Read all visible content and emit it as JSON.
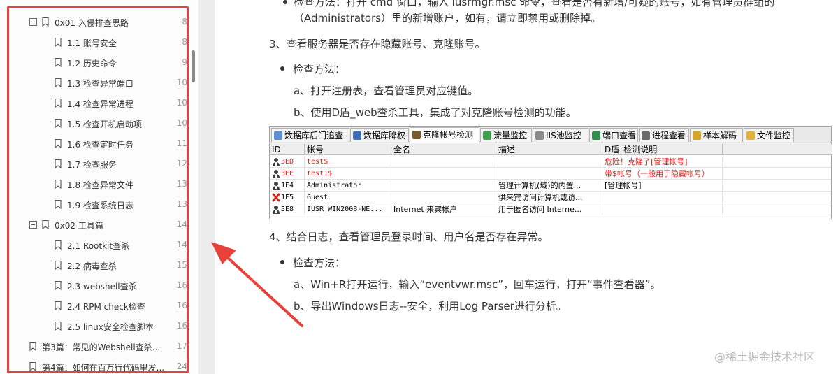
{
  "toc": {
    "items": [
      {
        "level": 1,
        "collapsible": true,
        "label": "0x01 入侵排查思路",
        "page": "8"
      },
      {
        "level": 2,
        "collapsible": false,
        "label": "1.1 账号安全",
        "page": "8"
      },
      {
        "level": 2,
        "collapsible": false,
        "label": "1.2 历史命令",
        "page": "9"
      },
      {
        "level": 2,
        "collapsible": false,
        "label": "1.3 检查异常端口",
        "page": "10"
      },
      {
        "level": 2,
        "collapsible": false,
        "label": "1.4 检查异常进程",
        "page": "10"
      },
      {
        "level": 2,
        "collapsible": false,
        "label": "1.5 检查开机启动项",
        "page": "10"
      },
      {
        "level": 2,
        "collapsible": false,
        "label": "1.6 检查定时任务",
        "page": "11"
      },
      {
        "level": 2,
        "collapsible": false,
        "label": "1.7 检查服务",
        "page": "12"
      },
      {
        "level": 2,
        "collapsible": false,
        "label": "1.8 检查异常文件",
        "page": "13"
      },
      {
        "level": 2,
        "collapsible": false,
        "label": "1.9 检查系统日志",
        "page": "13"
      },
      {
        "level": 1,
        "collapsible": true,
        "label": "0x02 工具篇",
        "page": "14"
      },
      {
        "level": 2,
        "collapsible": false,
        "label": "2.1 Rootkit查杀",
        "page": "14"
      },
      {
        "level": 2,
        "collapsible": false,
        "label": "2.2 病毒查杀",
        "page": "15"
      },
      {
        "level": 2,
        "collapsible": false,
        "label": "2.3 webshell查杀",
        "page": "16"
      },
      {
        "level": 2,
        "collapsible": false,
        "label": "2.4 RPM check检查",
        "page": "16"
      },
      {
        "level": 2,
        "collapsible": false,
        "label": "2.5 linux安全检查脚本",
        "page": "16"
      },
      {
        "level": 0,
        "collapsible": false,
        "label": "第3篇：常见的Webshell查杀...",
        "page": "17"
      },
      {
        "level": 0,
        "collapsible": false,
        "label": "第4篇：如何在百万行代码里发...",
        "page": "24"
      }
    ]
  },
  "doc": {
    "line_top_partial": "检查方法：打开 cmd 窗口，输入 lusrmgr.msc 命令，查看是否有新增/可疑的账号，如有管理员群组的",
    "line_admins": "（Administrators）里的新增账户，如有，请立即禁用或删除掉。",
    "step3": "3、查看服务器是否存在隐藏账号、克隆账号。",
    "method_label_1": "检查方法：",
    "step3_a": "a、打开注册表，查看管理员对应键值。",
    "step3_b": "b、使用D盾_web查杀工具，集成了对克隆账号检测的功能。",
    "step4": "4、结合日志，查看管理员登录时间、用户名是否存在异常。",
    "method_label_2": "检查方法：",
    "step4_a": "a、Win+R打开运行，输入“eventvwr.msc”，回车运行，打开“事件查看器”。",
    "step4_b": "b、导出Windows日志--安全，利用Log Parser进行分析。"
  },
  "tool": {
    "tabs": [
      {
        "label": "数据库后门追查",
        "icon": "db-search-icon"
      },
      {
        "label": "数据库降权",
        "icon": "db-lower-icon"
      },
      {
        "label": "克隆帐号检测",
        "icon": "user-clone-icon",
        "active": true
      },
      {
        "label": "流量监控",
        "icon": "traffic-icon"
      },
      {
        "label": "IIS池监控",
        "icon": "iis-icon"
      },
      {
        "label": "端口查看",
        "icon": "port-icon"
      },
      {
        "label": "进程查看",
        "icon": "process-icon"
      },
      {
        "label": "样本解码",
        "icon": "decode-icon"
      },
      {
        "label": "文件监控",
        "icon": "folder-icon"
      }
    ],
    "columns": [
      "ID",
      "帐号",
      "全名",
      "描述",
      "D盾_检测说明"
    ],
    "rows": [
      {
        "icon": "user-icon",
        "id": "3ED",
        "account": "test$",
        "fullname": "",
        "desc": "",
        "note": "危险！克隆了[管理帐号]",
        "red": true
      },
      {
        "icon": "user-icon",
        "id": "3EE",
        "account": "test1$",
        "fullname": "",
        "desc": "",
        "note": "带$帐号（一般用于隐藏帐号）",
        "red": true
      },
      {
        "icon": "user-icon",
        "id": "1F4",
        "account": "Administrator",
        "fullname": "",
        "desc": "管理计算机(域)的内置...",
        "note": "[管理帐号]",
        "red": false
      },
      {
        "icon": "disabled-user-icon",
        "id": "1F5",
        "account": "Guest",
        "fullname": "",
        "desc": "供来宾访问计算机或访...",
        "note": "",
        "red": false
      },
      {
        "icon": "user-icon",
        "id": "3E8",
        "account": "IUSR_WIN2008-NE...",
        "fullname": "Internet 来宾帐户",
        "desc": "用于匿名访问 Interne...",
        "note": "",
        "red": false
      }
    ]
  },
  "watermark": "@稀土掘金技术社区",
  "colors": {
    "highlight": "#e8413c",
    "danger_text": "#e0201c"
  }
}
